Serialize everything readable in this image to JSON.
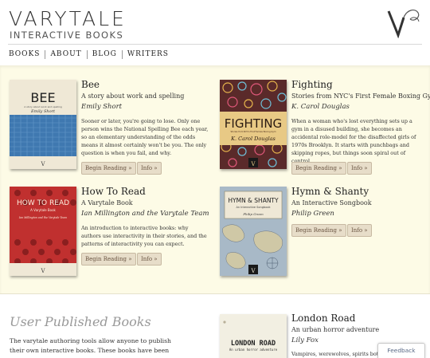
{
  "brand": {
    "name": "VARYTALE",
    "tagline": "INTERACTIVE BOOKS"
  },
  "nav": {
    "items": [
      "BOOKS",
      "ABOUT",
      "BLOG",
      "WRITERS"
    ]
  },
  "books": [
    {
      "title": "Bee",
      "subtitle": "A story about work and spelling",
      "author": "Emily Short",
      "description": "Sooner or later, you're going to lose. Only one person wins the National Spelling Bee each year, so an elementary understanding of the odds means it almost certainly won't be you. The only question is when you fail, and why.",
      "cover": {
        "title": "BEE",
        "subtitle": "A story about work and spelling",
        "author": "Emily Short",
        "colors": {
          "bg": "#3f78b0",
          "band": "#efe8d6"
        }
      },
      "begin_label": "Begin Reading »",
      "info_label": "Info »"
    },
    {
      "title": "Fighting",
      "subtitle": "Stories from NYC's First Female Boxing Gym",
      "author": "K. Carol Douglas",
      "description": "When a woman who's lost everything sets up a gym in a disused building, she becomes an accidental role-model for the disaffected girls of 1970s Brooklyn. It starts with punchbags and skipping ropes, but things soon spiral out of control.",
      "cover": {
        "title": "FIGHTING",
        "subtitle": "Stories from NYC's First Female Boxing Gym",
        "author": "K. Carol Douglas",
        "colors": {
          "bg": "#5a2a2a",
          "band": "#e8c985"
        }
      },
      "begin_label": "Begin Reading »",
      "info_label": "Info »"
    },
    {
      "title": "How To Read",
      "subtitle": "A Varytale Book",
      "author": "Ian Millington and the Varytale Team",
      "description": "An introduction to interactive books: why authors use interactivity in their stories, and the patterns of interactivity you can expect.",
      "cover": {
        "title": "HOW TO READ",
        "subtitle": "A Varytale Book",
        "author": "Ian Millington and the Varytale Team",
        "colors": {
          "bg": "#c0302f",
          "band": "#efe8d6"
        }
      },
      "begin_label": "Begin Reading »",
      "info_label": "Info »"
    },
    {
      "title": "Hymn & Shanty",
      "subtitle": "An Interactive Songbook",
      "author": "Philip Green",
      "description": "",
      "cover": {
        "title": "HYMN & SHANTY",
        "subtitle": "An Interactive Songbook",
        "author": "Philip Green",
        "colors": {
          "bg": "#a8b9c7",
          "band": "#efe8d6"
        }
      },
      "begin_label": "Begin Reading »",
      "info_label": "Info »"
    }
  ],
  "user_published": {
    "heading": "User Published Books",
    "text": "The varytale authoring tools allow anyone to publish their own interactive books. These books have been",
    "book": {
      "title": "London Road",
      "subtitle": "An urban horror adventure",
      "author": "Lily Fox",
      "description": "Vampires, werewolves, spirits both",
      "cover": {
        "title": "LONDON ROAD",
        "subtitle": "An urban horror adventure"
      }
    }
  },
  "feedback": {
    "label": "Feedback"
  },
  "colors": {
    "panel": "#fdfbe6",
    "button": "#e7ddc9",
    "button_text": "#6a5542",
    "muted_heading": "#999999"
  }
}
